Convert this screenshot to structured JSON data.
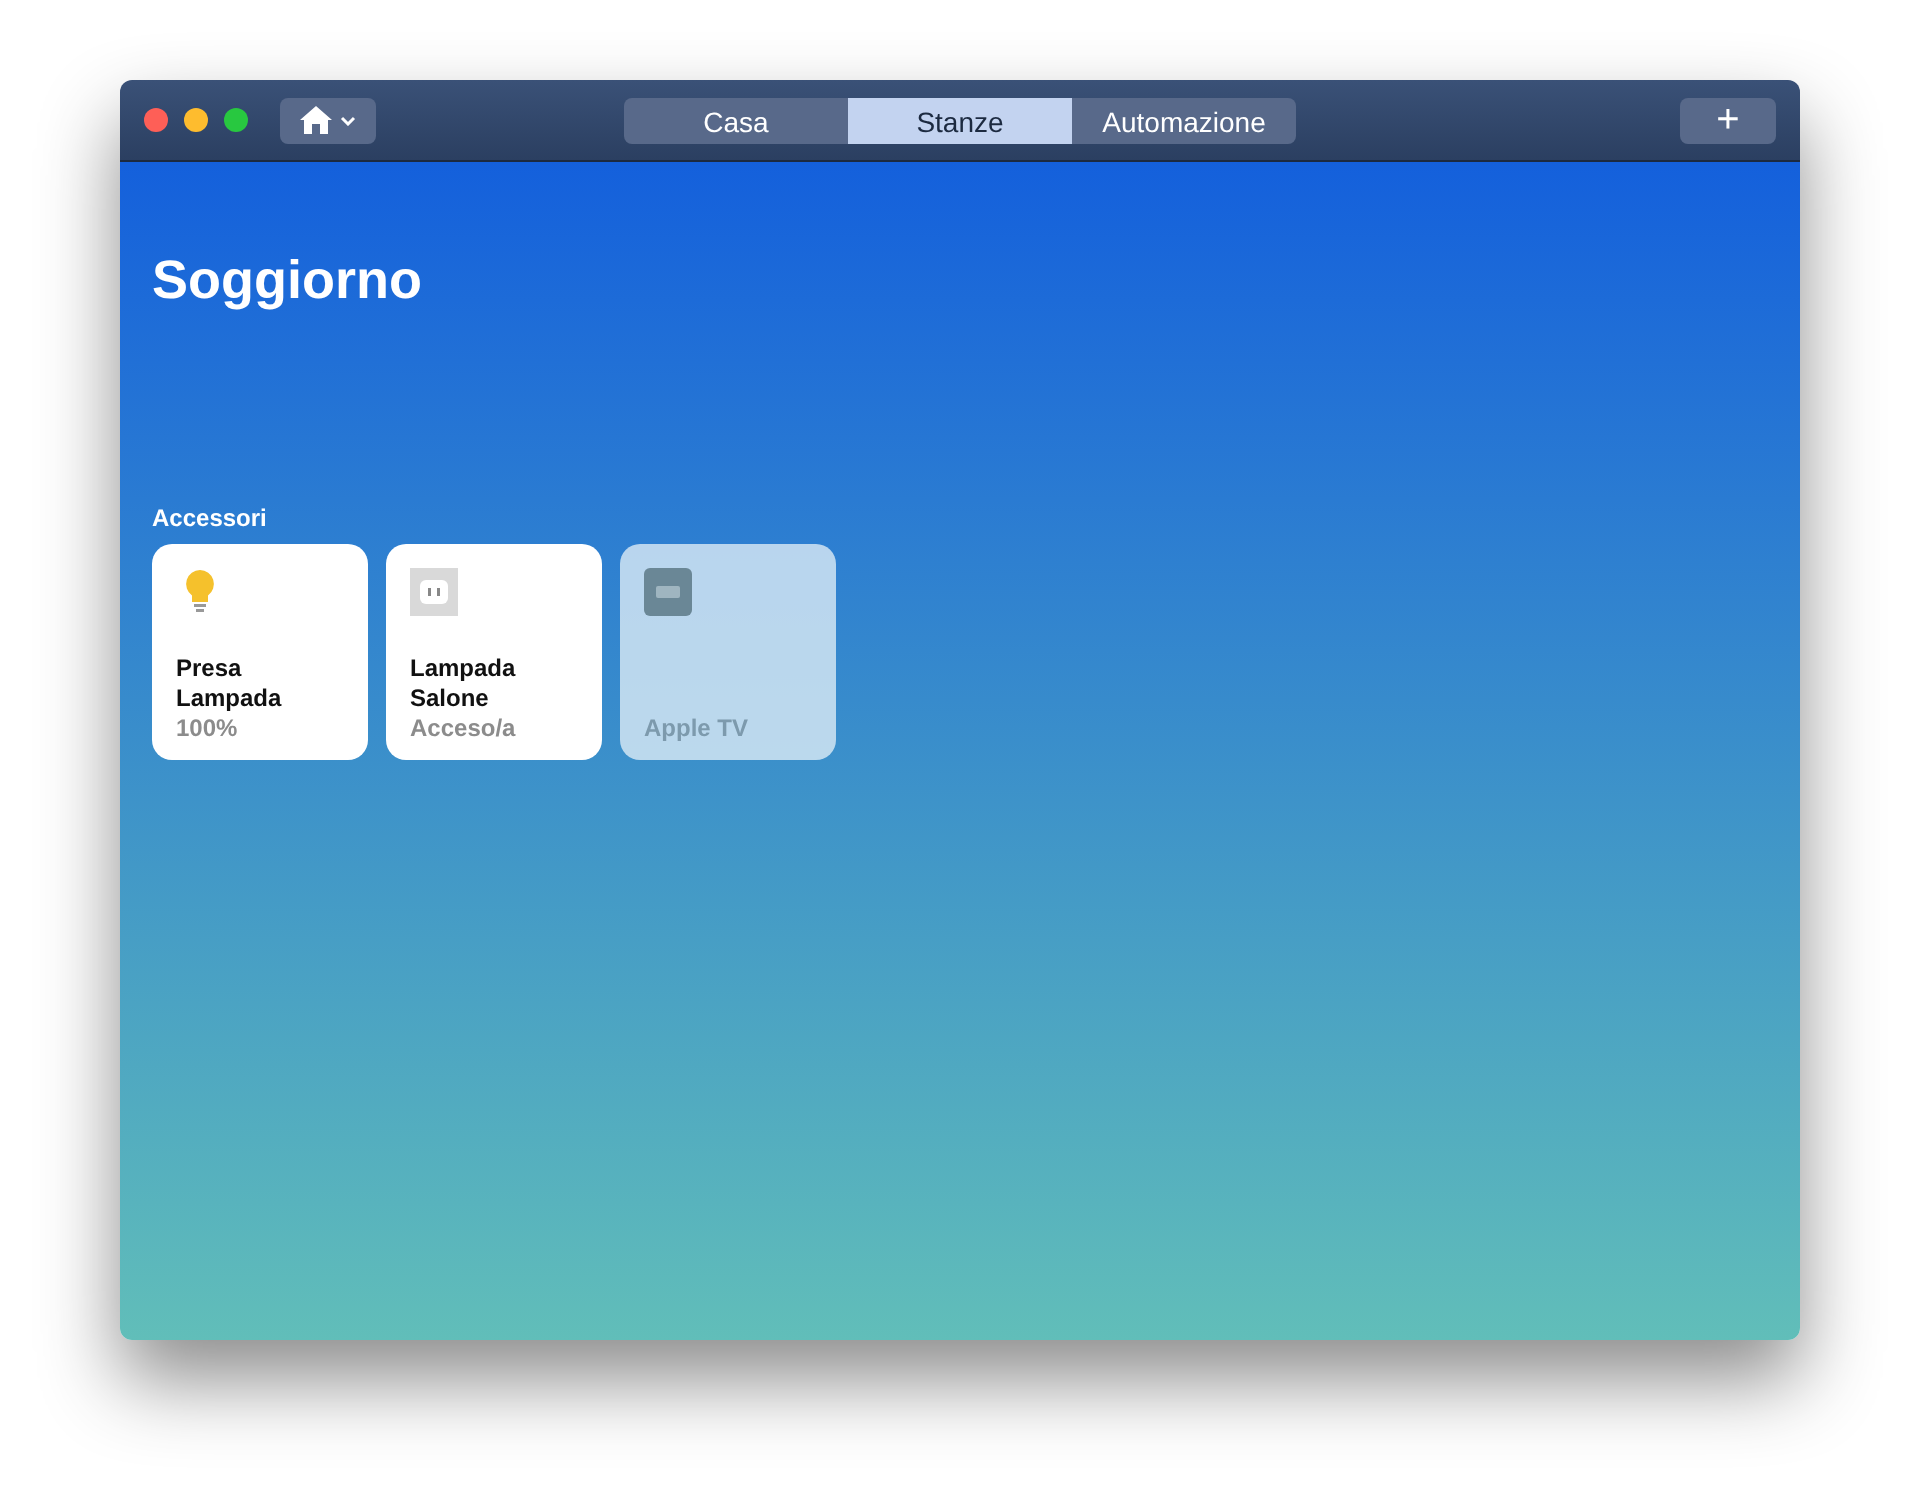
{
  "tabs": [
    {
      "label": "Casa",
      "selected": false
    },
    {
      "label": "Stanze",
      "selected": true
    },
    {
      "label": "Automazione",
      "selected": false
    }
  ],
  "add_button": {
    "label": "+"
  },
  "room": {
    "title": "Soggiorno"
  },
  "section": {
    "title": "Accessori"
  },
  "accessories": [
    {
      "kind": "light",
      "name": "Presa Lampada",
      "status": "100%",
      "on": true
    },
    {
      "kind": "outlet",
      "name": "Lampada Salone",
      "status": "Acceso/a",
      "on": true
    },
    {
      "kind": "tv",
      "name": "Apple TV",
      "on": false
    }
  ]
}
